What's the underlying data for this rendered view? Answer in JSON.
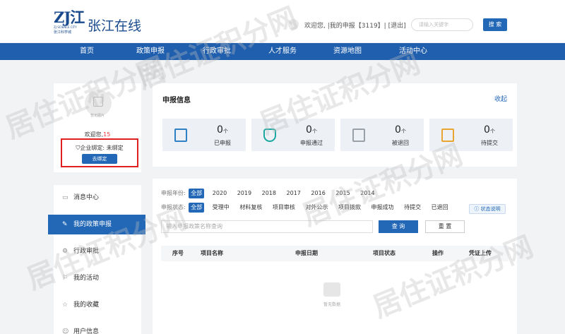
{
  "header": {
    "logo_big": "ZJ江",
    "logo_en": "ZJ SCIENCE CITY",
    "logo_cn": "张江科学城",
    "site_title": "张江在线",
    "welcome_text": "欢迎您,",
    "my_apply": "|我的申报【3119】|",
    "logout": "[退出]",
    "search_placeholder": "请输入关键字",
    "search_label": "搜 索"
  },
  "nav": {
    "items": [
      "首页",
      "政策申报",
      "行政审批",
      "人才服务",
      "资源地图",
      "活动中心"
    ]
  },
  "profile": {
    "photo_placeholder": "暂无图片",
    "welcome_prefix": "欢迎您,",
    "user_name": "15",
    "company_status": "企业绑定: 未绑定",
    "bind_button": "去绑定"
  },
  "sidebar": {
    "items": [
      "消息中心",
      "我的政策申报",
      "行政审批",
      "我的活动",
      "我的收藏",
      "用户信息"
    ],
    "active_index": 1
  },
  "info": {
    "title": "申报信息",
    "collapse": "收起",
    "stats": [
      {
        "count": "0",
        "unit": "个",
        "label": "已申报",
        "color": "#2f7fc4"
      },
      {
        "count": "0",
        "unit": "个",
        "label": "申报通过",
        "color": "#1aa8a0"
      },
      {
        "count": "0",
        "unit": "个",
        "label": "被退回",
        "color": "#9aa0a8"
      },
      {
        "count": "0",
        "unit": "个",
        "label": "待提交",
        "color": "#e8a630"
      }
    ]
  },
  "policy": {
    "year_label": "申报年份:",
    "years": [
      "全部",
      "2020",
      "2019",
      "2018",
      "2017",
      "2016",
      "2015",
      "2014"
    ],
    "status_label": "申报状态:",
    "statuses": [
      "全部",
      "受理中",
      "材料复核",
      "项目审核",
      "对外公示",
      "项目拨款",
      "申报成功",
      "待提交",
      "已退回"
    ],
    "status_help": "状态说明",
    "search_placeholder": "输入申报政策名称查询",
    "query_button": "查 询",
    "reset_button": "重 置",
    "table_headers": [
      "序号",
      "项目名称",
      "申报日期",
      "项目状态",
      "操作",
      "凭证上传"
    ],
    "empty_text": "暂无数据"
  },
  "watermark": "居住证积分网"
}
